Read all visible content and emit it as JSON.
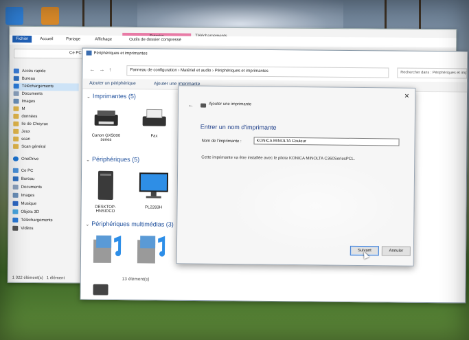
{
  "explorer": {
    "tabs": [
      "Fichier",
      "Accueil",
      "Partage",
      "Affichage"
    ],
    "tools_header": "Extraire",
    "tools_sub": "Outils de dossier compressé",
    "window_title": "Téléchargements",
    "address": "Ce PC",
    "quick_access": "Accès rapide",
    "nav_items": [
      "Bureau",
      "Téléchargements",
      "Documents",
      "Images",
      "M",
      "données",
      "Ile de Cheyrac",
      "Jeux",
      "scan",
      "Scan général"
    ],
    "onedrive": "OneDrive",
    "this_pc": "Ce PC",
    "pc_items": [
      "Bureau",
      "Documents",
      "Images",
      "Musique",
      "Objets 3D",
      "Téléchargements",
      "Vidéos"
    ],
    "status": "1 022 élément(s)",
    "status_sel": "1 élément"
  },
  "control_panel": {
    "title": "Périphériques et imprimantes",
    "breadcrumb": "Panneau de configuration  ›  Matériel et audio  ›  Périphériques et imprimantes",
    "search_placeholder": "Rechercher dans : Périphériques et imprimantes",
    "cmd_add_device": "Ajouter un périphérique",
    "cmd_add_printer": "Ajouter une imprimante",
    "section_printers": "Imprimantes (5)",
    "section_devices": "Périphériques (5)",
    "section_multimedia": "Périphériques multimédias (3)",
    "printers": [
      "Canon GX5000 series",
      "Fax"
    ],
    "devices": [
      "DESKTOP-HNSIDCO",
      "PL2283H"
    ],
    "status": "13 élément(s)"
  },
  "dialog": {
    "title": "Ajouter une imprimante",
    "heading": "Entrer un nom d'imprimante",
    "name_label": "Nom de l'imprimante :",
    "name_value": "KONICA MINOLTA Couleur",
    "info": "Cette imprimante va être installée avec le pilote KONICA MINOLTA C360SeriesPCL.",
    "next_label": "Suivant",
    "cancel_label": "Annuler"
  }
}
